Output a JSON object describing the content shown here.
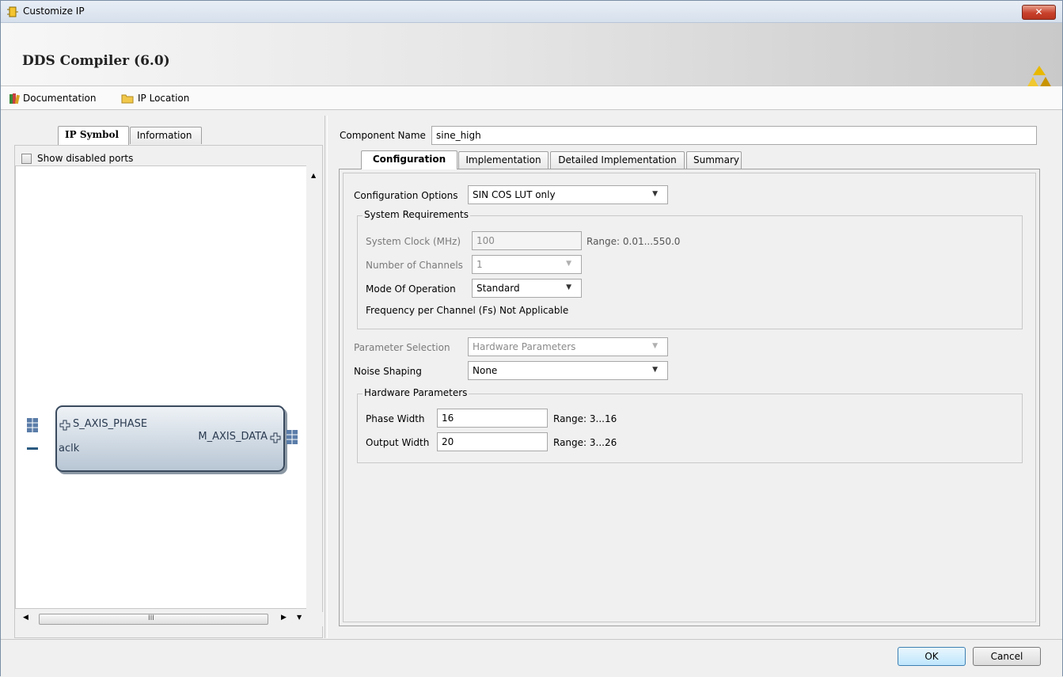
{
  "window": {
    "title": "Customize IP",
    "close_label": "✕"
  },
  "header": {
    "ip_title": "DDS Compiler (6.0)"
  },
  "links": {
    "documentation": "Documentation",
    "ip_location": "IP Location"
  },
  "left": {
    "tabs": [
      "IP Symbol",
      "Information"
    ],
    "show_disabled_ports": "Show disabled ports",
    "show_disabled_ports_checked": false,
    "symbol": {
      "ports_left": [
        "S_AXIS_PHASE",
        "aclk"
      ],
      "ports_right": [
        "M_AXIS_DATA"
      ]
    },
    "hscroll_grip": "III"
  },
  "right": {
    "component_name_label": "Component Name",
    "component_name_value": "sine_high",
    "tabs": [
      "Configuration",
      "Implementation",
      "Detailed Implementation",
      "Summary"
    ],
    "configuration_options_label": "Configuration Options",
    "configuration_options_value": "SIN COS LUT only",
    "system_requirements": {
      "title": "System Requirements",
      "system_clock_label": "System Clock (MHz)",
      "system_clock_value": "100",
      "system_clock_range": "Range: 0.01...550.0",
      "num_channels_label": "Number of Channels",
      "num_channels_value": "1",
      "mode_label": "Mode Of Operation",
      "mode_value": "Standard",
      "freq_text": "Frequency per Channel (Fs) Not Applicable"
    },
    "parameter_selection_label": "Parameter Selection",
    "parameter_selection_value": "Hardware Parameters",
    "noise_shaping_label": "Noise Shaping",
    "noise_shaping_value": "None",
    "hardware_parameters": {
      "title": "Hardware Parameters",
      "phase_width_label": "Phase Width",
      "phase_width_value": "16",
      "phase_width_range": "Range: 3...16",
      "output_width_label": "Output Width",
      "output_width_value": "20",
      "output_width_range": "Range: 3...26"
    }
  },
  "buttons": {
    "ok": "OK",
    "cancel": "Cancel"
  }
}
